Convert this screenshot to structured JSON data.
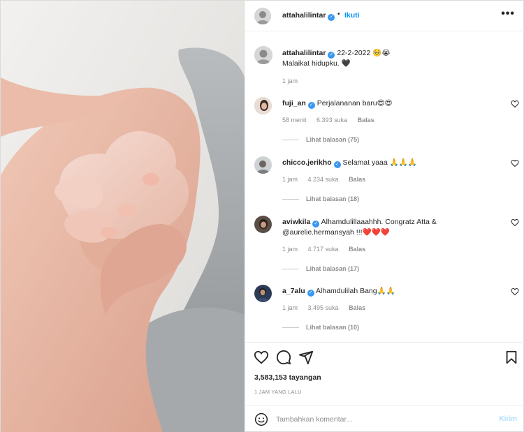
{
  "post": {
    "username": "attahalilintar",
    "follow_label": "Ikuti",
    "dot": "•",
    "more_label": "•••",
    "caption_date": "22-2-2022 🥺😭",
    "caption_text": "Malaikat hidupku. 🖤",
    "caption_time": "1 jam"
  },
  "comments": [
    {
      "username": "fuji_an",
      "text": "Perjalananan baru😍😍",
      "time": "58 menit",
      "likes": "6.393 suka",
      "reply": "Balas",
      "view_replies": "Lihat balasan (75)"
    },
    {
      "username": "chicco.jerikho",
      "text": "Selamat yaaa 🙏🙏🙏",
      "time": "1 jam",
      "likes": "4.234 suka",
      "reply": "Balas",
      "view_replies": "Lihat balasan (18)"
    },
    {
      "username": "aviwkila",
      "text": "Alhamdulillaaahhh. Congratz Atta &",
      "text2": "@aurelie.hermansyah !!!❤️❤️❤️",
      "time": "1 jam",
      "likes": "4.717 suka",
      "reply": "Balas",
      "view_replies": "Lihat balasan (17)"
    },
    {
      "username": "a_7alu",
      "text": "Alhamdulilah Bang🙏🙏",
      "time": "1 jam",
      "likes": "3.495 suka",
      "reply": "Balas",
      "view_replies": "Lihat balasan (10)"
    }
  ],
  "stats": {
    "views": "3,583,153 tayangan",
    "ago": "1 JAM YANG LALU"
  },
  "comment_box": {
    "placeholder": "Tambahkan komentar...",
    "send_label": "Kirim"
  },
  "colors": {
    "accent": "#0095f6",
    "verified": "#3897f0",
    "muted": "#8e8e8e",
    "heart_red": "#ed4956"
  }
}
